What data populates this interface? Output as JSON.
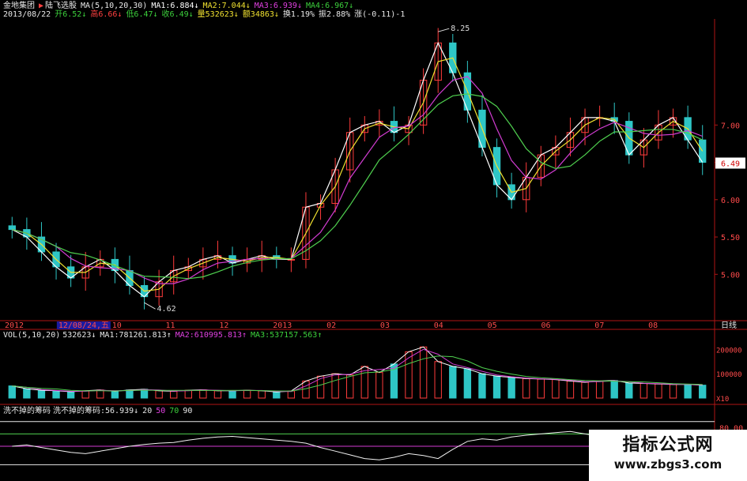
{
  "header": {
    "stock_name": "金地集团",
    "title_marker": "▶",
    "formula_name": "陆飞选股",
    "ma_params": "MA(5,10,20,30)",
    "ma1": "MA1:6.884↓",
    "ma2": "MA2:7.044↓",
    "ma3": "MA3:6.939↓",
    "ma4": "MA4:6.967↓",
    "date": "2013/08/22",
    "open": "开6.52↓",
    "high": "高6.66↓",
    "low": "低6.47↓",
    "close": "收6.49↓",
    "volume": "量532623↓",
    "amount": "额34863↓",
    "turnover": "换1.19%",
    "amplitude": "振2.88%",
    "change": "涨(-0.11)-1"
  },
  "colors": {
    "background": "#000000",
    "up": "#ff3b3b",
    "down": "#2ec6c6",
    "ma1": "#ffffff",
    "ma2": "#f0e130",
    "ma3": "#d23cd2",
    "ma4": "#4fd04f",
    "axis": "#b01515",
    "hdr_green": "#3cd03c",
    "hdr_red": "#ff4040",
    "hdr_magenta": "#e040e0",
    "hdr_white": "#e8e8e8"
  },
  "chart_data": [
    {
      "type": "candlestick",
      "title": "",
      "y_axis_labels": [
        "7.00",
        "6.50",
        "6.00",
        "5.50",
        "5.00"
      ],
      "ylim": [
        4.4,
        8.4
      ],
      "current_price_label": "6.49",
      "annotations": [
        {
          "text": "8.25",
          "x_label": "02",
          "value": 8.25
        },
        {
          "text": "4.62",
          "x_label": "12/08/24",
          "value": 4.62
        }
      ],
      "x_axis_labels": [
        "2012",
        "12/08/24,五",
        "10",
        "11",
        "12",
        "2013",
        "02",
        "03",
        "04",
        "05",
        "06",
        "07",
        "08"
      ],
      "period_label": "日线",
      "close_series_approx": [
        5.6,
        5.5,
        5.3,
        5.1,
        4.95,
        5.1,
        5.2,
        5.05,
        4.85,
        4.7,
        4.9,
        5.05,
        5.1,
        5.2,
        5.25,
        5.15,
        5.2,
        5.25,
        5.2,
        5.2,
        5.9,
        5.95,
        6.4,
        6.9,
        7.0,
        7.05,
        6.9,
        7.0,
        7.6,
        8.1,
        7.7,
        7.2,
        6.7,
        6.2,
        6.0,
        6.3,
        6.6,
        6.7,
        6.9,
        7.1,
        7.1,
        7.05,
        6.6,
        6.8,
        7.0,
        7.1,
        6.8,
        6.5
      ],
      "ma_series": [
        {
          "name": "MA1",
          "param": 5
        },
        {
          "name": "MA2",
          "param": 10
        },
        {
          "name": "MA3",
          "param": 20
        },
        {
          "name": "MA4",
          "param": 30
        }
      ]
    },
    {
      "type": "bar",
      "title": "VOL(5,10,20)",
      "legend": [
        "532623↓",
        "MA1:781261.813↑",
        "MA2:610995.813↑",
        "MA3:537157.563↑"
      ],
      "y_axis_labels": [
        "200000",
        "100000"
      ],
      "y_unit_label": "X10",
      "ylim": [
        0,
        2400000
      ],
      "values_approx": [
        500000,
        380000,
        320000,
        300000,
        260000,
        300000,
        330000,
        280000,
        330000,
        360000,
        300000,
        280000,
        320000,
        340000,
        300000,
        300000,
        320000,
        300000,
        250000,
        290000,
        700000,
        900000,
        1000000,
        950000,
        1300000,
        1050000,
        1400000,
        1900000,
        2100000,
        1500000,
        1300000,
        1200000,
        1000000,
        900000,
        850000,
        800000,
        780000,
        760000,
        700000,
        650000,
        700000,
        720000,
        620000,
        600000,
        580000,
        560000,
        560000,
        530000
      ]
    },
    {
      "type": "line",
      "title": "洗不掉的筹码",
      "legend": [
        "洗不掉的筹码:56.939↓",
        "20",
        "50",
        "70",
        "90"
      ],
      "y_axis_labels": [
        "80.00"
      ],
      "ylim": [
        0,
        100
      ],
      "reference_levels": [
        20,
        50,
        70,
        90
      ],
      "values_approx": [
        50,
        52,
        48,
        44,
        40,
        38,
        42,
        46,
        50,
        53,
        55,
        56,
        60,
        63,
        65,
        66,
        64,
        62,
        60,
        58,
        55,
        48,
        42,
        36,
        30,
        28,
        32,
        38,
        35,
        30,
        45,
        58,
        62,
        60,
        65,
        68,
        70,
        72,
        74,
        70,
        66,
        62,
        60,
        58,
        55,
        60,
        62,
        57
      ]
    }
  ],
  "watermark": {
    "title": "指标公式网",
    "url": "www.zbgs3.com"
  }
}
